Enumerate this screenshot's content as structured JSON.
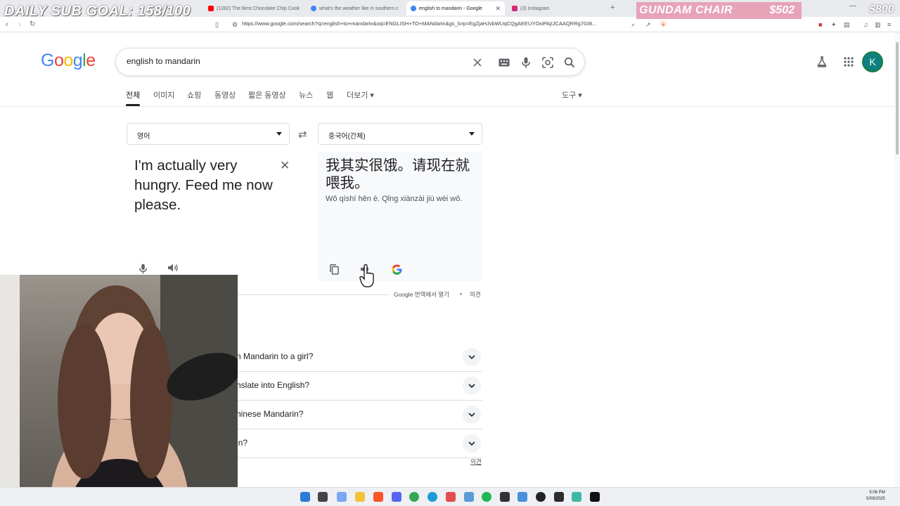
{
  "browser": {
    "tabs": [
      {
        "title": "(1282) The Best Chocolate Chip Cook",
        "favicon_color": "#ff0000"
      },
      {
        "title": "what's the weather like in southern c",
        "favicon_color": "#4285f4"
      },
      {
        "title": "english to mandarin - Google",
        "favicon_color": "#4285f4",
        "active": true
      },
      {
        "title": "(3) Instagram",
        "favicon_color": "#d62976"
      }
    ],
    "url": "https://www.google.com/search?q=english+to+mandarin&oq=ENGLISH+TO+MANdarin&gs_lcrp=EgZjaHJvbWUqCQgAEEUYOxiPAjIJCAAQRRg7GI8..."
  },
  "overlay": {
    "sub_goal": "DAILY SUB GOAL: 158/100",
    "goal_name": "GUNDAM CHAIR",
    "goal_current": "$502",
    "goal_target": "$800"
  },
  "google": {
    "search_query": "english to mandarin",
    "tabs": [
      "전체",
      "이미지",
      "쇼핑",
      "동영상",
      "짧은 동영상",
      "뉴스",
      "웹",
      "더보기 ▾"
    ],
    "tools": "도구 ▾",
    "avatar_letter": "K"
  },
  "translate": {
    "source_lang": "영어",
    "target_lang": "중국어(간체)",
    "source_text": "I'm actually very hungry. Feed me now please.",
    "target_text": "我其实很饿。请现在就喂我。",
    "pinyin": "Wǒ qíshí hěn è. Qǐng xiànzài jiù wèi wǒ.",
    "open_in_translate": "Google 번역에서 열기",
    "bullet": "•",
    "feedback": "의견"
  },
  "people_also_ask": [
    "n Mandarin to a girl?",
    "nslate into English?",
    "hinese Mandarin?",
    "in?"
  ],
  "paa_feedback": "의견",
  "taskbar": {
    "time": "5:06 PM",
    "date": "5/09/2025",
    "icons": [
      "start-icon",
      "files-icon",
      "copilot-icon",
      "folder-icon",
      "brave-icon",
      "discord-icon",
      "chrome-icon",
      "edge-icon",
      "music-icon",
      "app-icon",
      "spotify-icon",
      "terminal-icon",
      "photos-icon",
      "obs-icon",
      "cmd-icon",
      "notepad-icon",
      "app2-icon"
    ]
  }
}
